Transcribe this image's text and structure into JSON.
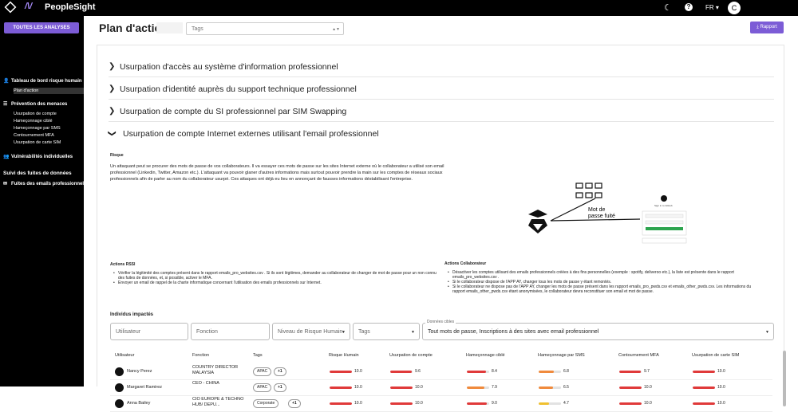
{
  "app": {
    "brand": "PeopleSight",
    "lang": "FR",
    "user_initial": "C"
  },
  "sidebar": {
    "all_analyses": "TOUTES LES ANALYSES",
    "dashboard": "Tableau de bord risque humain",
    "action_plan": "Plan d'action",
    "prevention": "Prévention des menaces",
    "prev_items": [
      "Usurpation de compte",
      "Hameçonnage ciblé",
      "Hameçonnage par SMS",
      "Contournement MFA",
      "Usurpation de carte SIM"
    ],
    "vulns": "Vulnérabilités individuelles",
    "leaks": "Suivi des fuites de données",
    "leak_emails": "Fuites des emails professionnels"
  },
  "header": {
    "title": "Plan d'action",
    "tags_placeholder": "Tags",
    "report": "Rapport"
  },
  "accordions": [
    "Usurpation d'accès au système d'information professionnel",
    "Usurpation d'identité auprès du support technique professionnel",
    "Usurpation de compte du SI professionnel par SIM Swapping",
    "Usurpation de compte Internet externes utilisant l'email professionnel"
  ],
  "risk": {
    "heading": "Risque",
    "text": "Un attaquant peut se procurer des mots de passe de vos collaborateurs. Il va essayer ces mots de passe sur les sites Internet externe où le collaborateur a utilisé son email professionnel (Linkedin, Twitter, Amazon etc.). L'attaquant va pouvoir glaner d'autres informations mais surtout pouvoir prendre la main sur les comptes de réseaux sociaux professionnels afin de parler au nom du collaborateur usurpé. Ces attaques ont déjà eu lieu en annonçant de fausses informations déstabilisant l'entreprise."
  },
  "illustration": {
    "label1": "Mot de",
    "label2": "passe fuité",
    "github_title": "Sign in to GitHub"
  },
  "actions_rssi": {
    "heading": "Actions RSSI",
    "items": [
      "Vérifier la légitimité des comptes présent dans le rapport emails_pro_websites.csv . Si ils sont légitimes, demander au collaborateur de changer de mot de passe pour un non connu des fuites de données, et, si possible, activer le MFA.",
      "Envoyer un email de rappel de la charte informatique concernant l'utilisation des emails professionnels sur Internet."
    ]
  },
  "actions_collab": {
    "heading": "Actions Collaborateur",
    "items": [
      "Désactiver les comptes utilisant des emails professionnels créées à des fins personnelles (exemple : spotify, deliveroo etc.), la liste est présente dans le rapport emails_pro_websites.csv .",
      "Si le collaborateur dispose de l'APP AY, changer tous les mots de passe y étant remontés.",
      "Si le collaborateur ne dispose pas de l'APP AY, changer les mots de passe présent dans les rapport emails_pro_pwds.csv et emails_other_pwds.csv. Les informations du rapport emails_other_pwds.csv étant anonymisées, le collaborateur devra reconstituer son email et mot de passe."
    ]
  },
  "impacted": {
    "heading": "Individus impactés",
    "filters": {
      "user": "Utilisateur",
      "function": "Fonction",
      "risk_level": "Niveau de Risque Humain",
      "tags": "Tags",
      "data_label": "Données cibles",
      "data_value": "Tout mots de passe, Inscriptions à des sites avec email professionnel"
    },
    "columns": [
      "Utilisateur",
      "Fonction",
      "Tags",
      "Risque Humain",
      "Usurpation de compte",
      "Hameçonnage ciblé",
      "Hameçonnage par SMS",
      "Contournement MFA",
      "Usurpation de carte SIM"
    ],
    "rows": [
      {
        "name": "Nancy Perez",
        "function": "COUNTRY DIRECTOR MALAYSIA",
        "tag": "APAC",
        "extra": "+1",
        "scores": [
          "10.0",
          "9.6",
          "8.4",
          "6.8",
          "9.7",
          "10.0"
        ]
      },
      {
        "name": "Margaret Ramirez",
        "function": "CEO - CHINA",
        "tag": "APAC",
        "extra": "+1",
        "scores": [
          "10.0",
          "10.0",
          "7.9",
          "6.5",
          "10.0",
          "10.0"
        ]
      },
      {
        "name": "Anna Bailey",
        "function": "CIO EUROPE & TECHNO HUB/ DEPU...",
        "tag": "Corporate",
        "extra": "+1",
        "scores": [
          "10.0",
          "10.0",
          "9.0",
          "4.7",
          "10.0",
          "10.0"
        ]
      }
    ]
  },
  "colors": {
    "accent": "#7c5cd6",
    "high": "#e03a3a",
    "mid": "#f08a3c",
    "low": "#f0c030"
  }
}
